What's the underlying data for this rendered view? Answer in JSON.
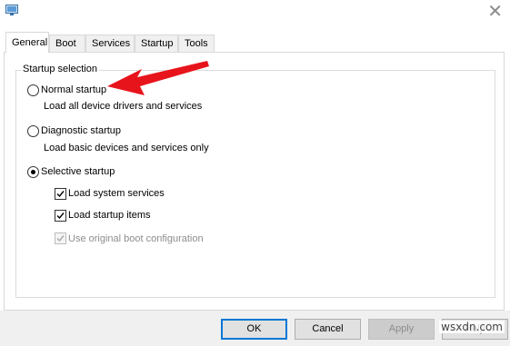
{
  "window": {
    "app_icon": "msconfig-icon",
    "close_icon": "close-icon",
    "close_glyph": "✕"
  },
  "tabs": [
    {
      "label": "General",
      "active": true
    },
    {
      "label": "Boot",
      "active": false
    },
    {
      "label": "Services",
      "active": false
    },
    {
      "label": "Startup",
      "active": false
    },
    {
      "label": "Tools",
      "active": false
    }
  ],
  "startup_selection": {
    "legend": "Startup selection",
    "normal": {
      "label": "Normal startup",
      "description": "Load all device drivers and services",
      "selected": false
    },
    "diagnostic": {
      "label": "Diagnostic startup",
      "description": "Load basic devices and services only",
      "selected": false
    },
    "selective": {
      "label": "Selective startup",
      "selected": true,
      "options": [
        {
          "label": "Load system services",
          "checked": true,
          "enabled": true
        },
        {
          "label": "Load startup items",
          "checked": true,
          "enabled": true
        },
        {
          "label": "Use original boot configuration",
          "checked": true,
          "enabled": false
        }
      ]
    }
  },
  "annotation": {
    "icon": "red-arrow-icon",
    "color": "#e8141c"
  },
  "buttons": {
    "ok": "OK",
    "cancel": "Cancel",
    "apply": "Apply",
    "help": "Help"
  },
  "watermark": "wsxdn.com"
}
